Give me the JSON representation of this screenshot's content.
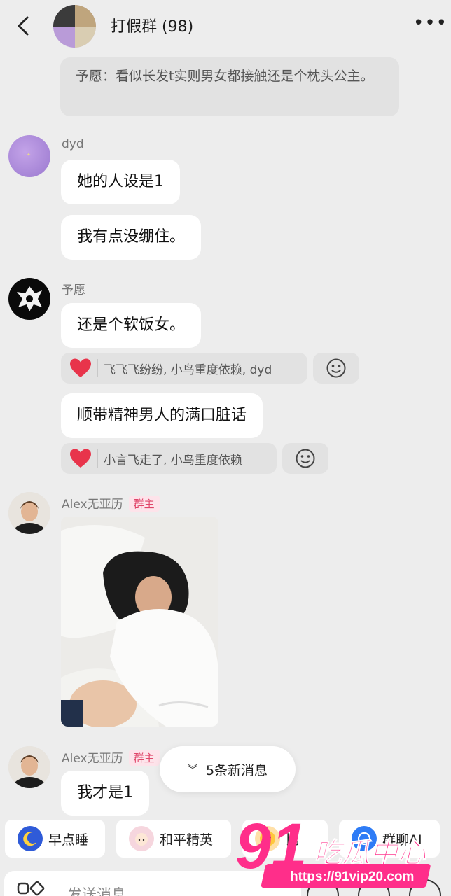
{
  "header": {
    "title": "打假群 (98)",
    "back_icon": "chevron-left-icon",
    "more_label": "•••"
  },
  "messages": {
    "quote_text": "予愿：看似长发t实则男女都接触还是个枕头公主。",
    "dyd": {
      "sender": "dyd",
      "msg1": "她的人设是1",
      "msg2": "我有点没绷住。"
    },
    "yuyuan": {
      "sender": "予愿",
      "msg1": "还是个软饭女。",
      "reaction1": "飞飞飞纷纷, 小鸟重度依赖, dyd",
      "msg2": "顺带精神男人的满口脏话",
      "reaction2": "小言飞走了, 小鸟重度依赖"
    },
    "alex1": {
      "sender": "Alex无亚历",
      "badge": "群主"
    },
    "alex2": {
      "sender": "Alex无亚历",
      "badge": "群主",
      "msg1": "我才是1"
    }
  },
  "new_messages_label": "5条新消息",
  "quick_actions": [
    "早点睡",
    "和平精英",
    "比",
    "群聊AI"
  ],
  "input": {
    "placeholder": "发送消息"
  },
  "watermark": {
    "brand": "91吃瓜中心",
    "url": "https://91vip20.com"
  },
  "colors": {
    "background": "#ededed",
    "bubble": "#ffffff",
    "badge_text": "#e0466a",
    "heart": "#e8344b",
    "watermark": "#ff2e8a"
  }
}
